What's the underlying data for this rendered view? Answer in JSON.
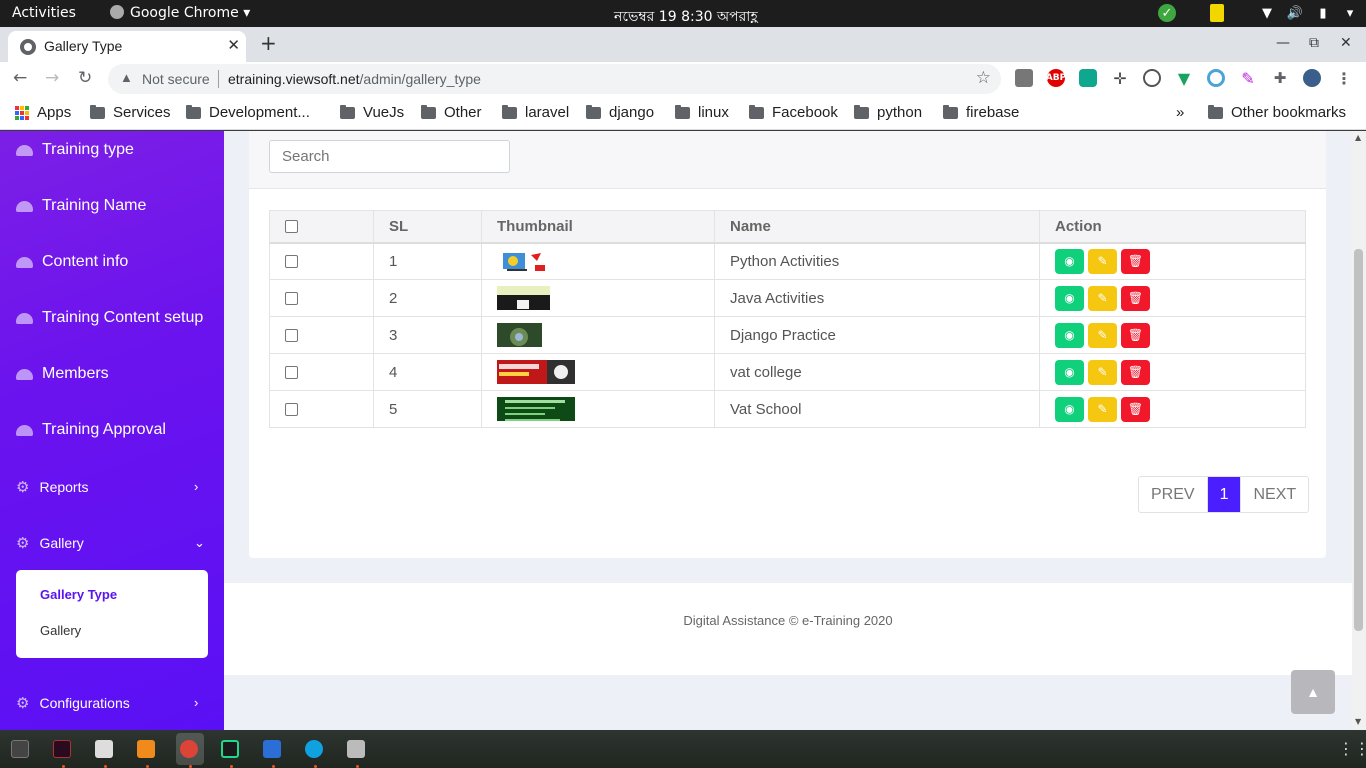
{
  "system": {
    "activities": "Activities",
    "app_name": "Google Chrome",
    "clock": "নভেম্বর 19  8:30 অপরাহ্ণ"
  },
  "browser": {
    "tab_title": "Gallery Type",
    "security_label": "Not secure",
    "url_domain": "etraining.viewsoft.net",
    "url_path": "/admin/gallery_type",
    "bookmarks": [
      "Apps",
      "Services",
      "Development...",
      "VueJs",
      "Other",
      "laravel",
      "django",
      "linux",
      "Facebook",
      "python",
      "firebase"
    ],
    "overflow": "»",
    "other_bookmarks": "Other bookmarks"
  },
  "sidebar": {
    "items": [
      {
        "label": "Training type"
      },
      {
        "label": "Training Name"
      },
      {
        "label": "Content info"
      },
      {
        "label": "Training Content setup"
      },
      {
        "label": "Members"
      },
      {
        "label": "Training Approval"
      },
      {
        "label": "Reports"
      },
      {
        "label": "Gallery"
      },
      {
        "label": "Configurations"
      }
    ],
    "submenu": {
      "active": "Gallery Type",
      "other": "Gallery"
    },
    "accent": "#6a15ee"
  },
  "main": {
    "search_placeholder": "Search",
    "columns": [
      "SL",
      "Thumbnail",
      "Name",
      "Action"
    ],
    "rows": [
      {
        "sl": "1",
        "name": "Python Activities"
      },
      {
        "sl": "2",
        "name": "Java Activities"
      },
      {
        "sl": "3",
        "name": "Django Practice"
      },
      {
        "sl": "4",
        "name": "vat college"
      },
      {
        "sl": "5",
        "name": "Vat School"
      }
    ],
    "pagination": {
      "prev": "PREV",
      "current": "1",
      "next": "NEXT"
    },
    "footer": "Digital Assistance © e-Training 2020",
    "colors": {
      "view": "#10d07b",
      "edit": "#f5c710",
      "delete": "#f0182a",
      "page_active": "#4b1eff"
    }
  }
}
